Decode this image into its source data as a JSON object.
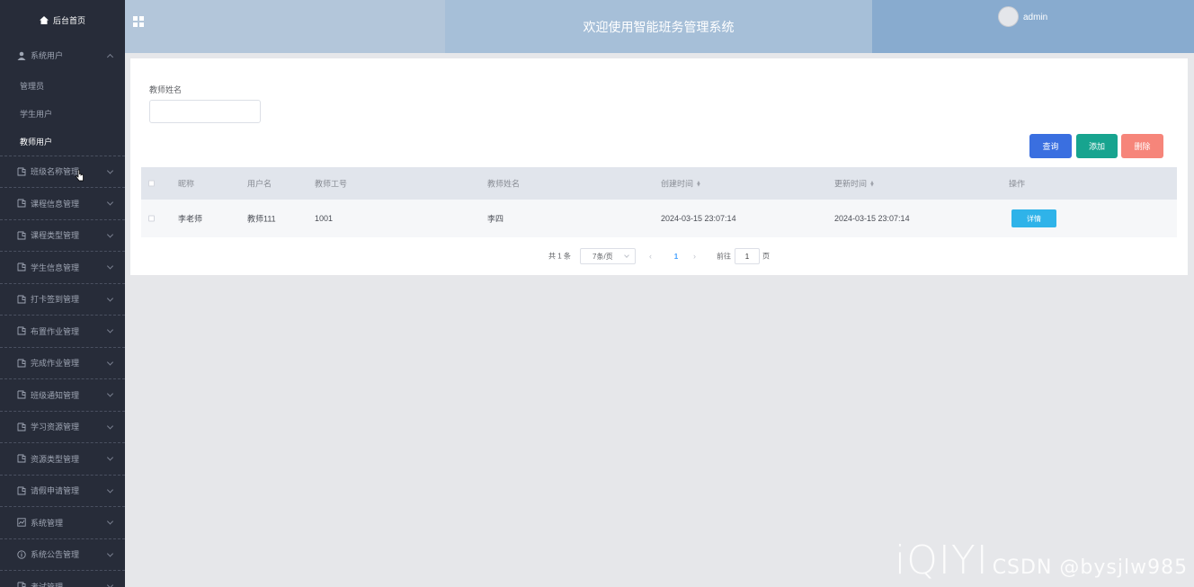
{
  "sidebar": {
    "home_label": "后台首页",
    "open_group": {
      "label": "系统用户",
      "items": [
        "管理员",
        "学生用户",
        "教师用户"
      ],
      "active_index": 2
    },
    "groups": [
      "班级名称管理",
      "课程信息管理",
      "课程类型管理",
      "学生信息管理",
      "打卡签到管理",
      "布置作业管理",
      "完成作业管理",
      "班级通知管理",
      "学习资源管理",
      "资源类型管理",
      "请假申请管理",
      "系统管理",
      "系统公告管理",
      "考试管理"
    ]
  },
  "header": {
    "title": "欢迎使用智能班务管理系统",
    "username": "admin",
    "colors": {
      "left": "#b3c6da",
      "center": "#a6bfd8",
      "right": "#88abcf"
    }
  },
  "search": {
    "label": "教师姓名",
    "value": "",
    "placeholder": ""
  },
  "buttons": {
    "query": "查询",
    "add": "添加",
    "delete": "删除"
  },
  "table": {
    "headers": [
      "昵称",
      "用户名",
      "教师工号",
      "教师姓名",
      "创建时间",
      "更新时间",
      "操作"
    ],
    "rows": [
      {
        "nickname": "李老师",
        "username": "教师111",
        "teacher_no": "1001",
        "teacher_name": "李四",
        "created": "2024-03-15 23:07:14",
        "updated": "2024-03-15 23:07:14",
        "action": "详情"
      }
    ]
  },
  "pagination": {
    "total": "共 1 条",
    "page_size": "7条/页",
    "current_page": "1",
    "goto_label": "前往",
    "goto_value": "1",
    "page_unit": "页"
  },
  "watermark": {
    "logo": "iQIYI",
    "text": "CSDN @bysjlw985"
  }
}
